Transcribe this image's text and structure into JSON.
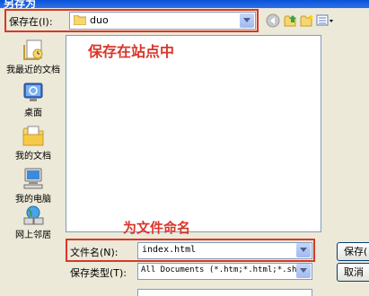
{
  "window": {
    "title": "另存为"
  },
  "savein": {
    "label": "保存在(I):",
    "value": "duo"
  },
  "places": [
    {
      "label": "我最近的文档",
      "icon": "recent-documents-icon"
    },
    {
      "label": "桌面",
      "icon": "desktop-icon"
    },
    {
      "label": "我的文档",
      "icon": "my-documents-icon"
    },
    {
      "label": "我的电脑",
      "icon": "my-computer-icon"
    },
    {
      "label": "网上邻居",
      "icon": "network-places-icon"
    }
  ],
  "annotations": {
    "top": "保存在站点中",
    "bottom": "为文件命名"
  },
  "filename": {
    "label": "文件名(N):",
    "value": "index.html"
  },
  "savetype": {
    "label": "保存类型(T):",
    "value": "All Documents (*.htm;*.html;*.shtm;*."
  },
  "buttons": {
    "save": "保存(",
    "cancel": "取消"
  },
  "colors": {
    "annotation": "#d9362a",
    "title_bar": "#0a52d8",
    "dialog_bg": "#ece9d8",
    "field_border": "#7f9db9"
  }
}
